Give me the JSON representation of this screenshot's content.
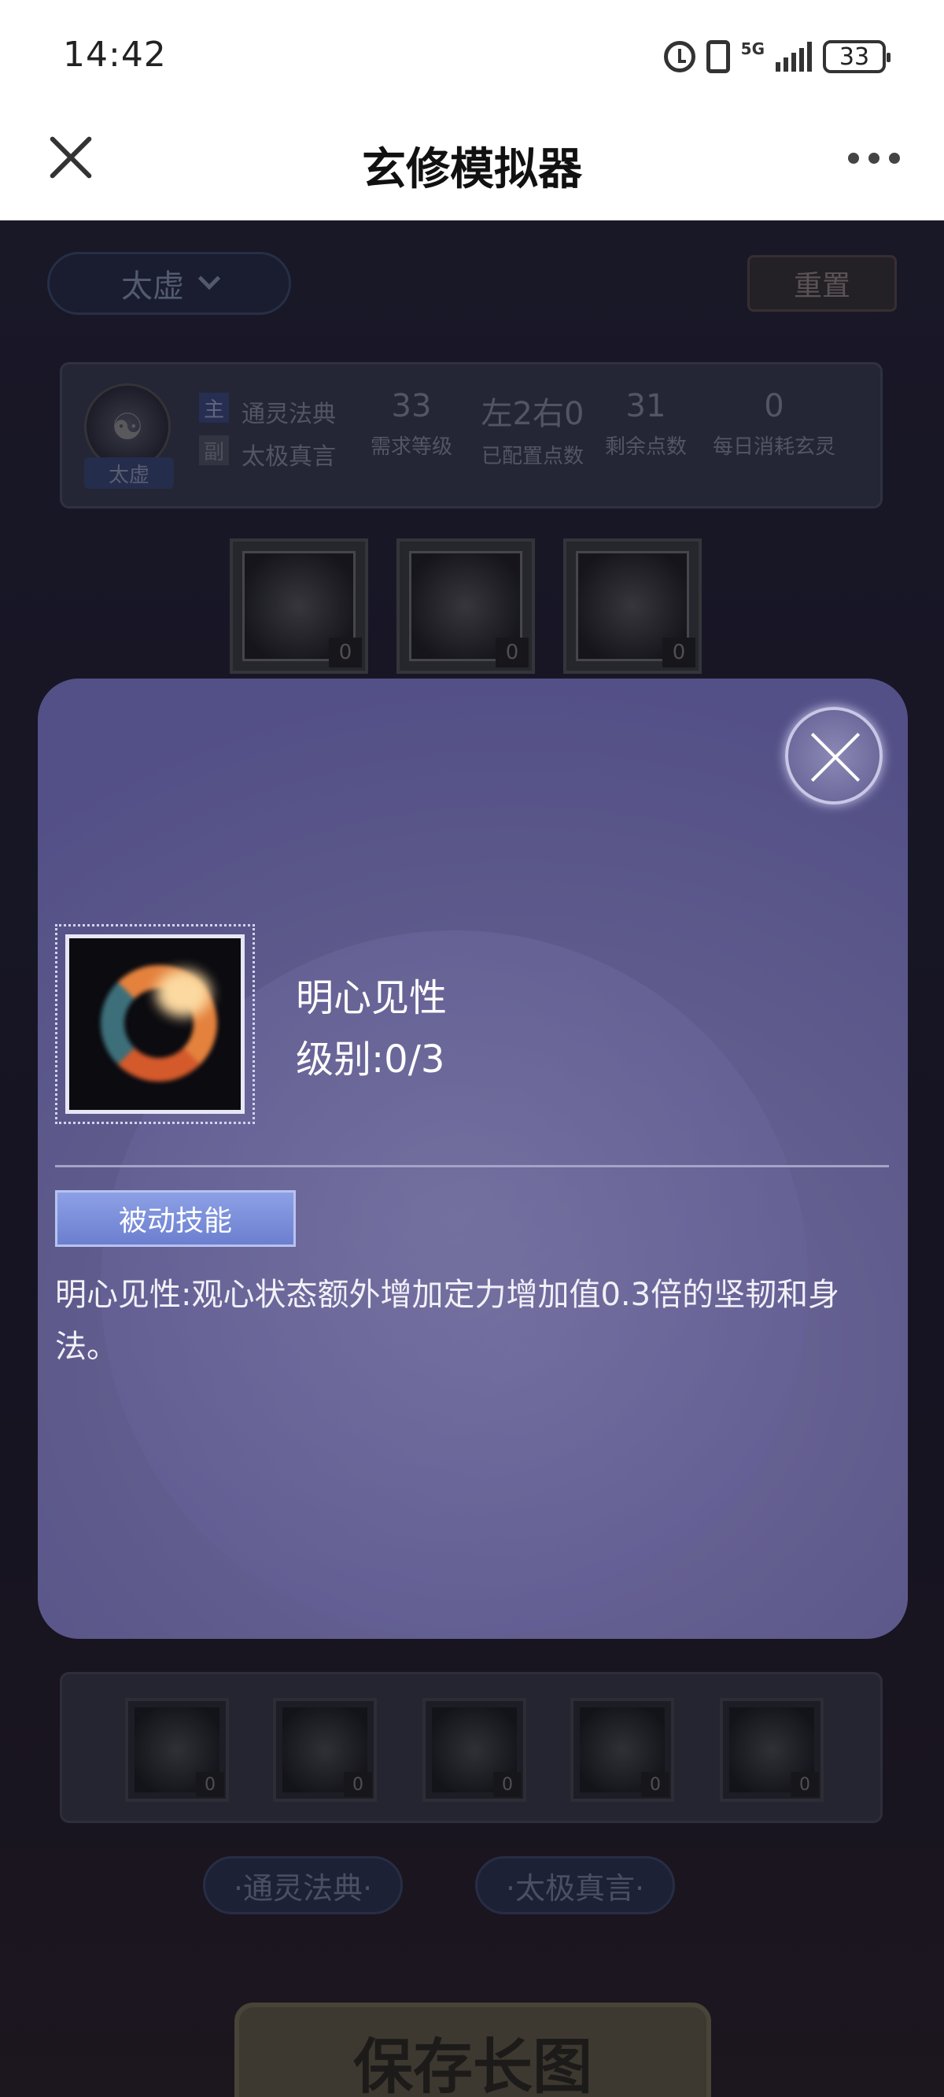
{
  "status_bar": {
    "time": "14:42",
    "icons": [
      "alarm-icon",
      "vibrate-icon",
      "5g-signal-icon",
      "battery-icon"
    ],
    "network": "5G",
    "battery": "33"
  },
  "nav": {
    "title": "玄修模拟器",
    "close_icon": "close-icon",
    "more_icon": "more-icon"
  },
  "background_page": {
    "sect_select": "太虚",
    "reset_label": "重置",
    "avatar_badge": "太虚",
    "avatar_glyph": "☯",
    "main_tag": "主",
    "sub_tag": "副",
    "main_inheritance": "通灵法典",
    "sub_inheritance": "太极真言",
    "stats": [
      {
        "value": "33",
        "label": "需求等级"
      },
      {
        "value": "左2右0",
        "label": "已配置点数"
      },
      {
        "value": "31",
        "label": "剩余点数"
      },
      {
        "value": "0",
        "label": "每日消耗玄灵"
      }
    ],
    "top_skill_counts": [
      "0",
      "0",
      "0"
    ],
    "bottom_skill_counts": [
      "0",
      "0",
      "0",
      "0",
      "0"
    ],
    "tabs": [
      "·通灵法典·",
      "·太极真言·"
    ],
    "save_label": "保存长图"
  },
  "modal": {
    "skill_name": "明心见性",
    "skill_level": "级别:0/3",
    "type_tag": "被动技能",
    "description": "明心见性:观心状态额外增加定力增加值0.3倍的坚韧和身法。"
  }
}
